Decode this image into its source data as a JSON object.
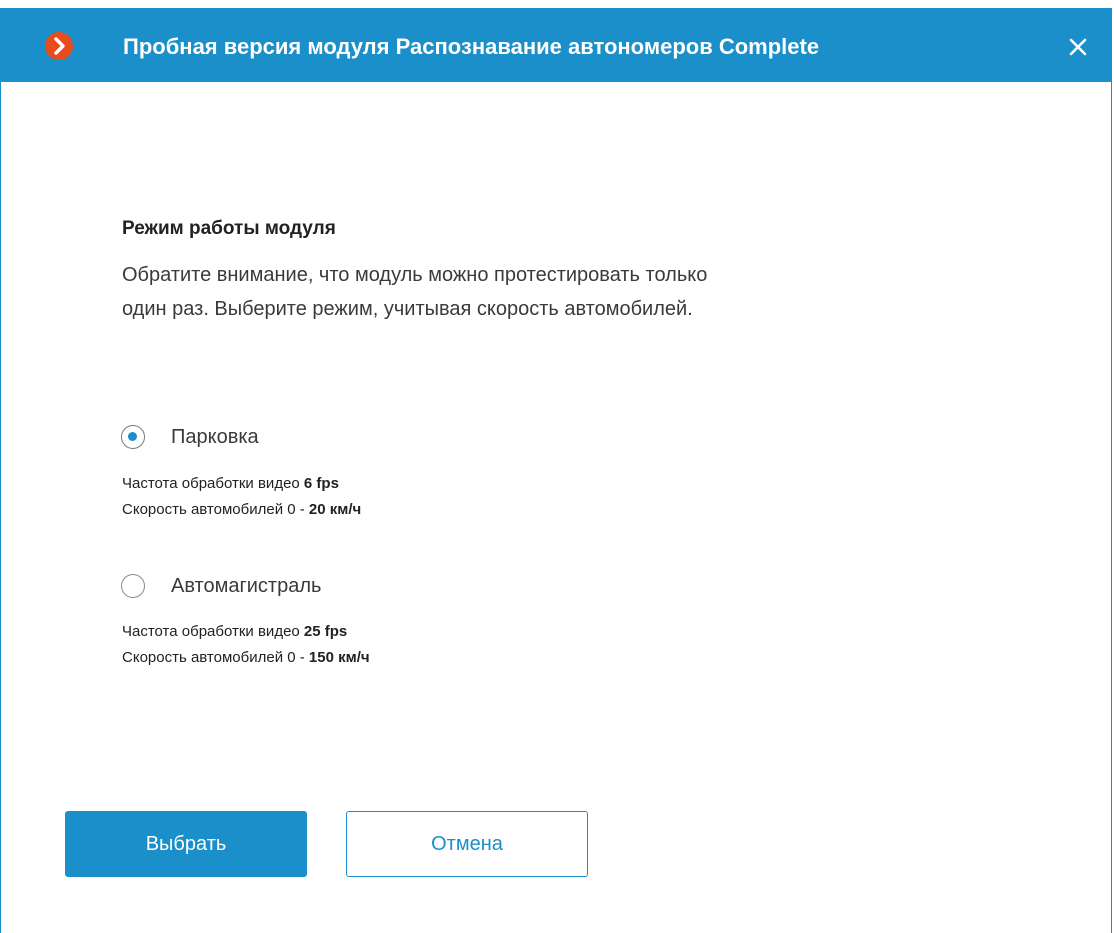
{
  "dialog": {
    "title": "Пробная версия модуля Распознавание автономеров Complete",
    "logo_icon": "app-logo-chevron-icon",
    "close_icon": "close-icon",
    "accent_color": "#1a8fc9",
    "logo_color": "#e84c1c"
  },
  "content": {
    "section_title": "Режим работы модуля",
    "notice_line1": "Обратите внимание, что модуль можно протестировать только",
    "notice_line2": "один раз. Выберите режим, учитывая скорость автомобилей."
  },
  "modes": [
    {
      "label": "Парковка",
      "selected": true,
      "fps_prefix": "Частота обработки видео ",
      "fps_value": "6 fps",
      "speed_prefix": "Скорость автомобилей 0 - ",
      "speed_value": "20 км/ч"
    },
    {
      "label": "Автомагистраль",
      "selected": false,
      "fps_prefix": "Частота обработки видео ",
      "fps_value": "25 fps",
      "speed_prefix": "Скорость автомобилей 0 - ",
      "speed_value": "150 км/ч"
    }
  ],
  "buttons": {
    "select_label": "Выбрать",
    "cancel_label": "Отмена"
  }
}
